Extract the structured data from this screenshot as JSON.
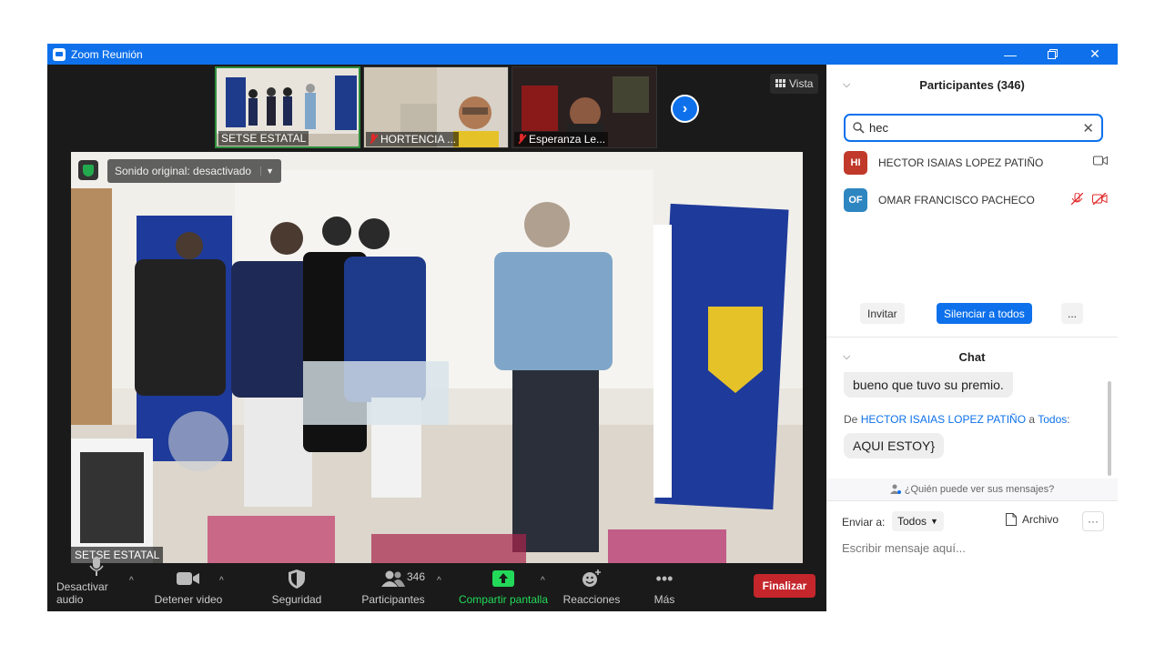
{
  "window": {
    "title": "Zoom Reunión"
  },
  "thumbnails": [
    {
      "name": "SETSE ESTATAL",
      "muted": false,
      "active": true
    },
    {
      "name": "HORTENCIA ...",
      "muted": true,
      "active": false
    },
    {
      "name": "Esperanza Le...",
      "muted": true,
      "active": false
    }
  ],
  "view_button": "Vista",
  "main_video": {
    "sound_label": "Sonido original: desactivado",
    "speaker_name": "SETSE ESTATAL"
  },
  "toolbar": {
    "audio": "Desactivar audio",
    "video": "Detener video",
    "security": "Seguridad",
    "participants": "Participantes",
    "participants_count": "346",
    "share": "Compartir pantalla",
    "reactions": "Reacciones",
    "more": "Más",
    "end": "Finalizar"
  },
  "participants_panel": {
    "title": "Participantes (346)",
    "search_value": "hec",
    "people": [
      {
        "initials": "HI",
        "name": "HECTOR ISAIAS LOPEZ PATIÑO",
        "color": "#c0392b"
      },
      {
        "initials": "OF",
        "name": "OMAR FRANCISCO PACHECO",
        "color": "#2e86c1"
      }
    ],
    "invite": "Invitar",
    "mute_all": "Silenciar a todos",
    "more": "..."
  },
  "chat": {
    "title": "Chat",
    "prev_message": "bueno que tuvo su premio.",
    "from_prefix": "De",
    "from_name": "HECTOR ISAIAS LOPEZ PATIÑO",
    "to_word": "a",
    "to_name": "Todos",
    "message": "AQUI ESTOY}",
    "who_can_see": "¿Quién puede ver sus mensajes?",
    "send_to_label": "Enviar a:",
    "send_to_value": "Todos",
    "file_label": "Archivo",
    "input_placeholder": "Escribir mensaje aquí..."
  },
  "colors": {
    "accent": "#0e71eb",
    "end": "#c4262b",
    "share": "#23d959"
  }
}
